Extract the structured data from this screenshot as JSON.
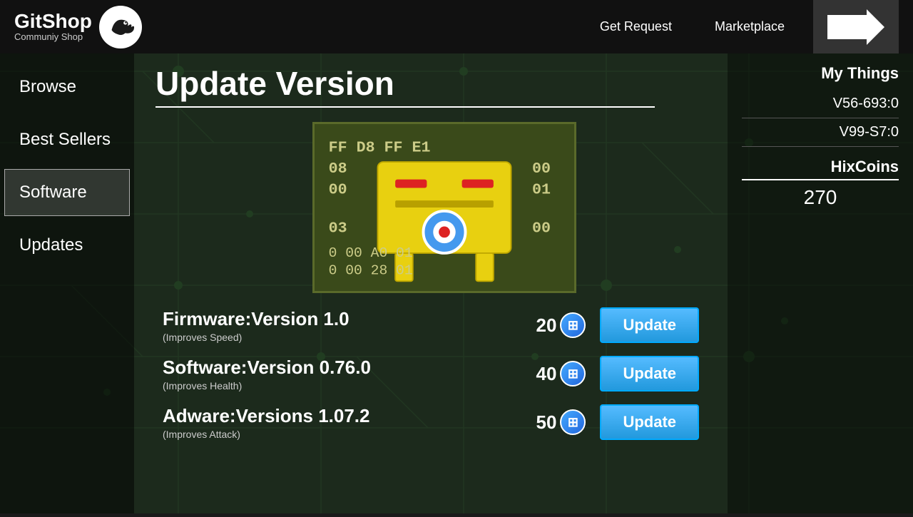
{
  "header": {
    "logo_title": "GitShop",
    "logo_subtitle": "Communiy Shop",
    "nav": {
      "get_request": "Get Request",
      "marketplace": "Marketplace"
    }
  },
  "sidebar": {
    "items": [
      {
        "id": "browse",
        "label": "Browse",
        "active": false
      },
      {
        "id": "best-sellers",
        "label": "Best Sellers",
        "active": false
      },
      {
        "id": "software",
        "label": "Software",
        "active": true
      },
      {
        "id": "updates",
        "label": "Updates",
        "active": false
      }
    ]
  },
  "main": {
    "page_title": "Update Version",
    "updates": [
      {
        "name": "Firmware:Version 1.0",
        "desc": "(Improves Speed)",
        "price": "20",
        "btn_label": "Update"
      },
      {
        "name": "Software:Version 0.76.0",
        "desc": "(Improves Health)",
        "price": "40",
        "btn_label": "Update"
      },
      {
        "name": "Adware:Versions 1.07.2",
        "desc": "(Improves Attack)",
        "price": "50",
        "btn_label": "Update"
      }
    ]
  },
  "right_panel": {
    "my_things_label": "My Things",
    "items": [
      {
        "id": "v56",
        "label": "V56-693:0"
      },
      {
        "id": "v99",
        "label": "V99-S7:0"
      }
    ],
    "hixcoins_label": "HixCoins",
    "hixcoins_value": "270"
  },
  "icons": {
    "hix_symbol": "⊞"
  }
}
